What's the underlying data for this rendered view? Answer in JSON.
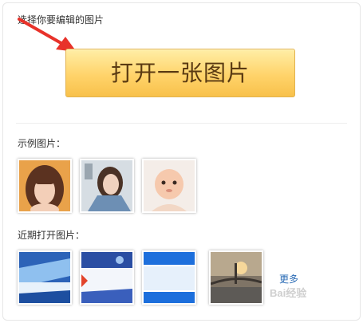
{
  "header": {
    "title": "选择你要编辑的图片"
  },
  "open_button": {
    "label": "打开一张图片"
  },
  "examples": {
    "label": "示例图片：",
    "items": [
      "girl-bangs-photo",
      "girl-selfie-photo",
      "baby-photo"
    ]
  },
  "recent": {
    "label": "近期打开图片：",
    "items": [
      "blue-abstract-1",
      "blue-abstract-2",
      "blue-white-banner",
      "bridge-sunset"
    ],
    "more_label": "更多"
  },
  "watermark": {
    "text": "Bai经验"
  },
  "colors": {
    "button": "#ffd36a",
    "button_text": "#5a3a12",
    "link": "#2a6bb5",
    "arrow": "#e8322a"
  }
}
